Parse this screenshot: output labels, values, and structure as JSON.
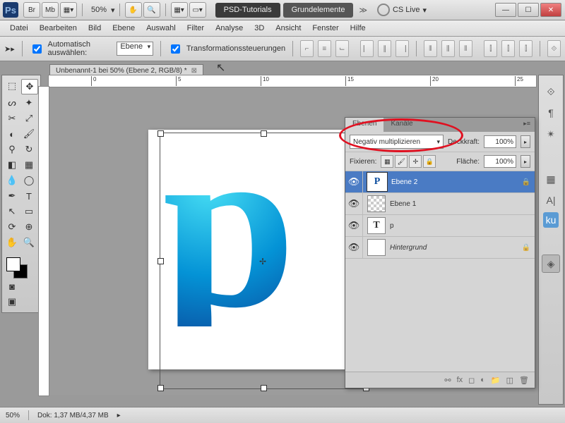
{
  "titlebar": {
    "zoom": "50%",
    "psd_tutorials": "PSD-Tutorials",
    "grundelemente": "Grundelemente",
    "cslive": "CS Live"
  },
  "menu": [
    "Datei",
    "Bearbeiten",
    "Bild",
    "Ebene",
    "Auswahl",
    "Filter",
    "Analyse",
    "3D",
    "Ansicht",
    "Fenster",
    "Hilfe"
  ],
  "options": {
    "auto_select_label": "Automatisch auswählen:",
    "auto_select_value": "Ebene",
    "transform_label": "Transformationssteuerungen"
  },
  "doc_tab": "Unbenannt-1 bei 50% (Ebene 2, RGB/8) *",
  "ruler_marks": [
    "0",
    "5",
    "10",
    "15",
    "20",
    "25"
  ],
  "panel": {
    "tabs": {
      "ebenen": "Ebenen",
      "kanale": "Kanäle"
    },
    "blend_mode": "Negativ multiplizieren",
    "deckkraft_label": "Deckkraft:",
    "deckkraft_value": "100%",
    "fixieren_label": "Fixieren:",
    "flache_label": "Fläche:",
    "flache_value": "100%",
    "layers": [
      {
        "name": "Ebene 2",
        "thumb": "P",
        "selected": true,
        "locked": true
      },
      {
        "name": "Ebene 1",
        "thumb": "",
        "checker": true
      },
      {
        "name": "p",
        "thumb": "T"
      },
      {
        "name": "Hintergrund",
        "thumb": "",
        "italic": true,
        "locked": true
      }
    ]
  },
  "status": {
    "zoom": "50%",
    "dok": "Dok: 1,37 MB/4,37 MB"
  }
}
